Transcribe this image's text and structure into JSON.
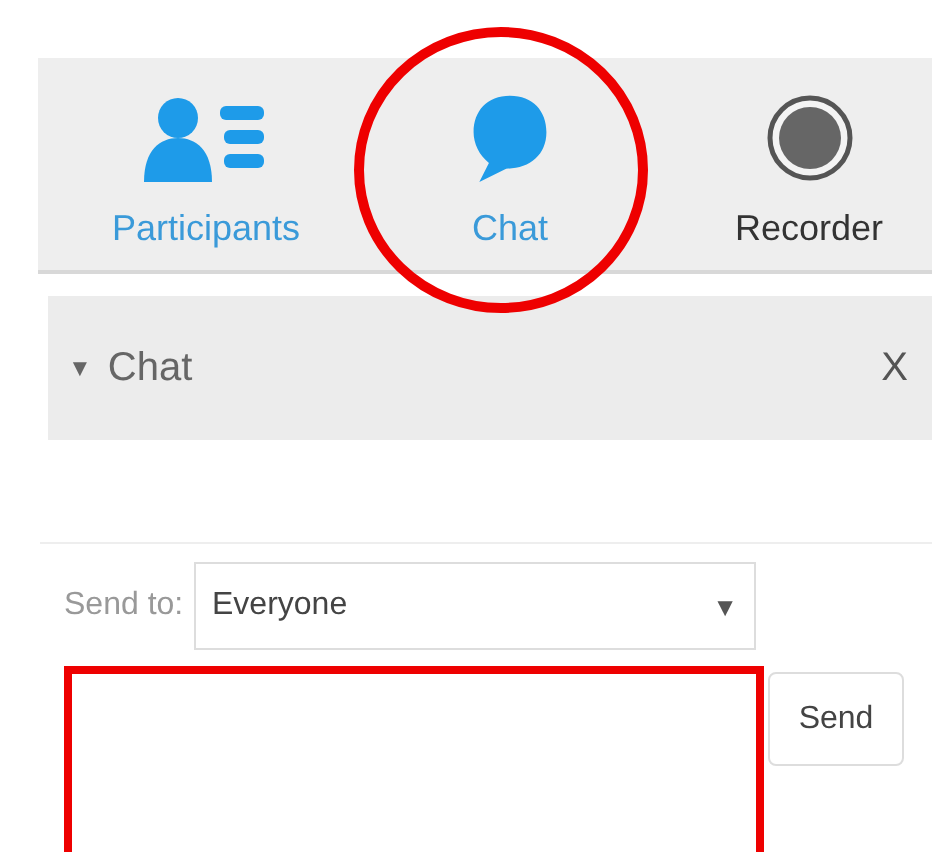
{
  "tabs": [
    {
      "label": "Participants",
      "kind": "participants",
      "color": "#3a9ad9",
      "highlighted": false
    },
    {
      "label": "Chat",
      "kind": "chat",
      "color": "#3a9ad9",
      "highlighted": true
    },
    {
      "label": "Recorder",
      "kind": "recorder",
      "color": "#333333",
      "highlighted": false
    }
  ],
  "chat_panel": {
    "toggle": "▼",
    "title": "Chat",
    "close": "X"
  },
  "send_to": {
    "label": "Send to:",
    "value": "Everyone",
    "caret": "▼"
  },
  "message": {
    "highlighted": true
  },
  "send_button": "Send"
}
